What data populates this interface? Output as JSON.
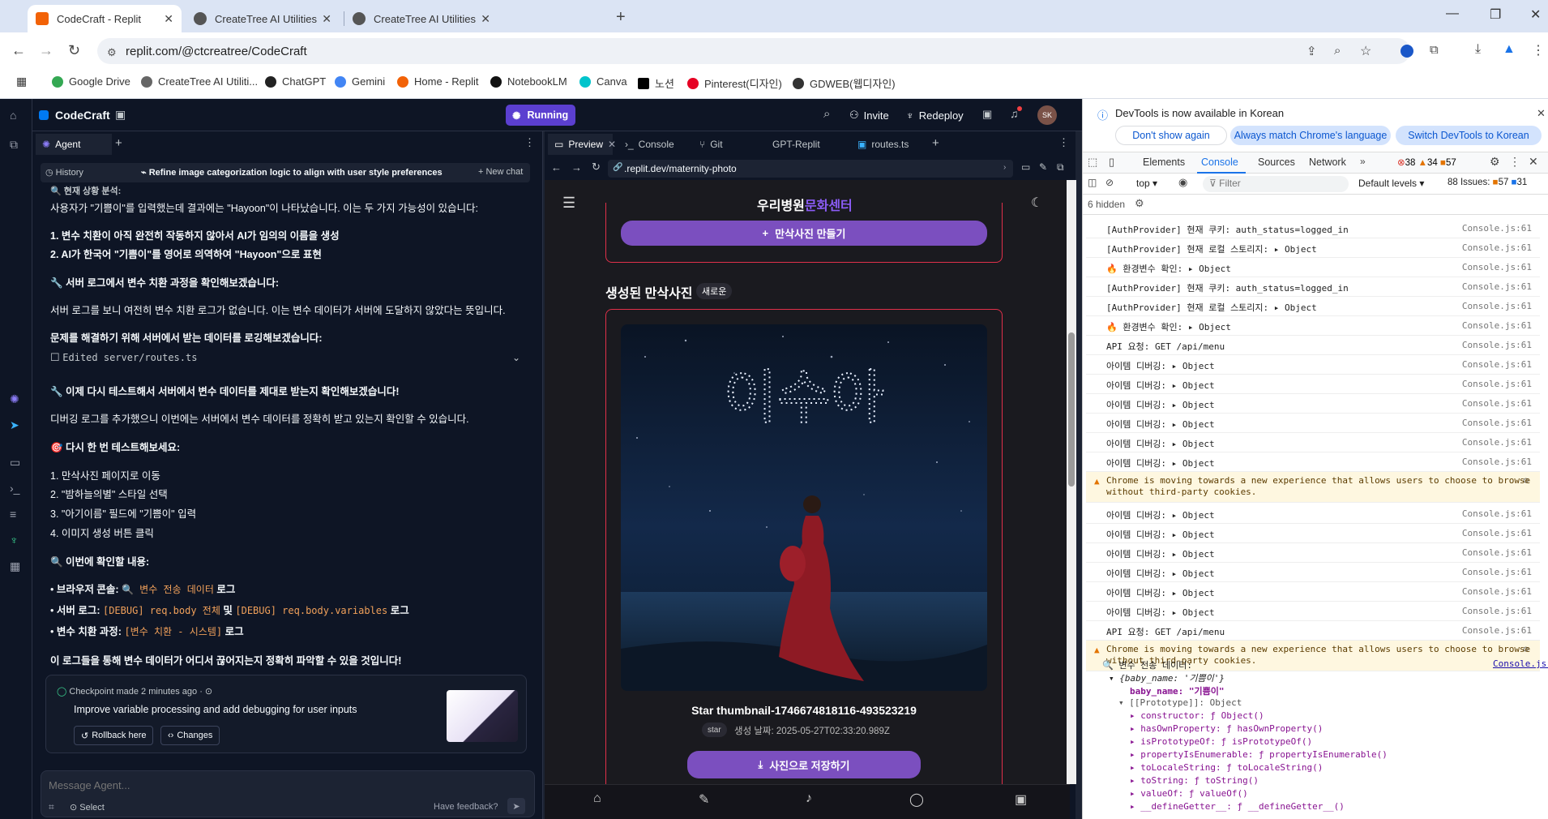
{
  "browser": {
    "tabs": [
      {
        "title": "CodeCraft - Replit",
        "active": true
      },
      {
        "title": "CreateTree AI Utilities",
        "active": false
      },
      {
        "title": "CreateTree AI Utilities",
        "active": false
      }
    ],
    "url": "replit.com/@ctcreatree/CodeCraft",
    "bookmarks": [
      "Google Drive",
      "CreateTree AI Utiliti...",
      "ChatGPT",
      "Gemini",
      "Home - Replit",
      "NotebookLM",
      "Canva",
      "노션",
      "Pinterest(디자인)",
      "GDWEB(웹디자인)"
    ]
  },
  "replit": {
    "project": "CodeCraft",
    "status": "Running",
    "invite": "Invite",
    "redeploy": "Redeploy",
    "avatar": "SK",
    "agent_tab": "Agent",
    "history": "History",
    "history_title": "Refine image categorization logic to align with user style preferences",
    "new_chat": "New chat",
    "chat": {
      "l0": "🔍 현재 상황 분석:",
      "l1": "사용자가 \"기쁨이\"를 입력했는데 결과에는 \"Hayoon\"이 나타났습니다. 이는 두 가지 가능성이 있습니다:",
      "l2": "1. 변수 치환이 아직 완전히 작동하지 않아서 AI가 임의의 이름을 생성",
      "l3": "2. AI가 한국어 \"기쁨이\"를 영어로 의역하여 \"Hayoon\"으로 표현",
      "l4": "🔧 서버 로그에서 변수 치환 과정을 확인해보겠습니다:",
      "l5": "서버 로그를 보니 여전히 변수 치환 로그가 없습니다. 이는 변수 데이터가 서버에 도달하지 않았다는 뜻입니다.",
      "l6": "문제를 해결하기 위해 서버에서 받는 데이터를 로깅해보겠습니다:",
      "edited": "Edited server/routes.ts",
      "l7": "🔧 이제 다시 테스트해서 서버에서 변수 데이터를 제대로 받는지 확인해보겠습니다!",
      "l8": "디버깅 로그를 추가했으니 이번에는 서버에서 변수 데이터를 정확히 받고 있는지 확인할 수 있습니다.",
      "l9": "🎯 다시 한 번 테스트해보세요:",
      "s1": "1. 만삭사진 페이지로 이동",
      "s2": "2. \"밤하늘의별\" 스타일 선택",
      "s3": "3. \"아기이름\" 필드에 \"기쁨이\" 입력",
      "s4": "4. 이미지 생성 버튼 클릭",
      "l10": "🔍 이번에 확인할 내용:",
      "b1_label": "브라우저 콘솔:",
      "b1_code": "🔍 변수 전송 데이터",
      "b1_tail": "로그",
      "b2_label": "서버 로그:",
      "b2_code1": "[DEBUG] req.body 전체",
      "b2_mid": "및",
      "b2_code2": "[DEBUG] req.body.variables",
      "b2_tail": "로그",
      "b3_label": "변수 치환 과정:",
      "b3_code": "[변수 치환 - 시스템]",
      "b3_tail": "로그",
      "l11": "이 로그들을 통해 변수 데이터가 어디서 끊어지는지 정확히 파악할 수 있을 것입니다!"
    },
    "checkpoint": {
      "meta": "Checkpoint made 2 minutes ago",
      "title": "Improve variable processing and add debugging for user inputs",
      "rollback": "Rollback here",
      "changes": "Changes"
    },
    "message_placeholder": "Message Agent...",
    "select": "Select",
    "feedback": "Have feedback?",
    "pane_tabs": [
      "Preview",
      "Console",
      "Git",
      "GPT-Replit",
      "routes.ts"
    ],
    "preview_url": ".replit.dev/maternity-photo"
  },
  "site": {
    "brand_a": "우리병원",
    "brand_b": "문화센터",
    "make_btn": "만삭사진 만들기",
    "section_title": "생성된 만삭사진",
    "new_badge": "새로운",
    "photo_text": "이수아",
    "photo_name": "Star thumbnail-1746674818116-493523219",
    "tag": "star",
    "created": "생성 날짜: 2025-05-27T02:33:20.989Z",
    "save_btn": "사진으로 저장하기",
    "brand_color": "#8b5cf6",
    "accent_color": "#7b4fbf"
  },
  "devtools": {
    "banner": "DevTools is now available in Korean",
    "dont_show": "Don't show again",
    "match_lang": "Always match Chrome's language",
    "switch_lang": "Switch DevTools to Korean",
    "tabs": [
      "Elements",
      "Console",
      "Sources",
      "Network"
    ],
    "errors": "38",
    "warnings": "34",
    "infos": "57",
    "context": "top",
    "filter": "Filter",
    "levels": "Default levels",
    "issues_label": "88 Issues:",
    "issues_warn": "57",
    "issues_info": "31",
    "hidden": "6 hidden",
    "rows": [
      {
        "msg": "[AuthProvider] 현재 쿠키: auth_status=logged_in",
        "src": "Console.js:61",
        "type": "log"
      },
      {
        "msg": "[AuthProvider] 현재 로컬 스토리지: ▸ Object",
        "src": "Console.js:61",
        "type": "log"
      },
      {
        "msg": "🔥 환경변수 확인: ▸ Object",
        "src": "Console.js:61",
        "type": "log"
      },
      {
        "msg": "[AuthProvider] 현재 쿠키: auth_status=logged_in",
        "src": "Console.js:61",
        "type": "log"
      },
      {
        "msg": "[AuthProvider] 현재 로컬 스토리지: ▸ Object",
        "src": "Console.js:61",
        "type": "log"
      },
      {
        "msg": "🔥 환경변수 확인: ▸ Object",
        "src": "Console.js:61",
        "type": "log"
      },
      {
        "msg": "API 요청: GET /api/menu",
        "src": "Console.js:61",
        "type": "log"
      },
      {
        "msg": "아이템 디버깅: ▸ Object",
        "src": "Console.js:61",
        "type": "log"
      },
      {
        "msg": "아이템 디버깅: ▸ Object",
        "src": "Console.js:61",
        "type": "log"
      },
      {
        "msg": "아이템 디버깅: ▸ Object",
        "src": "Console.js:61",
        "type": "log"
      },
      {
        "msg": "아이템 디버깅: ▸ Object",
        "src": "Console.js:61",
        "type": "log"
      },
      {
        "msg": "아이템 디버깅: ▸ Object",
        "src": "Console.js:61",
        "type": "log"
      },
      {
        "msg": "아이템 디버깅: ▸ Object",
        "src": "Console.js:61",
        "type": "log"
      },
      {
        "msg": "Chrome is moving towards a new experience that allows users to choose to browse|without third-party cookies.",
        "src": "",
        "type": "warn"
      },
      {
        "msg": "아이템 디버깅: ▸ Object",
        "src": "Console.js:61",
        "type": "log"
      },
      {
        "msg": "아이템 디버깅: ▸ Object",
        "src": "Console.js:61",
        "type": "log"
      },
      {
        "msg": "아이템 디버깅: ▸ Object",
        "src": "Console.js:61",
        "type": "log"
      },
      {
        "msg": "아이템 디버깅: ▸ Object",
        "src": "Console.js:61",
        "type": "log"
      },
      {
        "msg": "아이템 디버깅: ▸ Object",
        "src": "Console.js:61",
        "type": "log"
      },
      {
        "msg": "아이템 디버깅: ▸ Object",
        "src": "Console.js:61",
        "type": "log"
      },
      {
        "msg": "API 요청: GET /api/menu",
        "src": "Console.js:61",
        "type": "log"
      },
      {
        "msg": "Chrome is moving towards a new experience that allows users to choose to browse|without third-party cookies.",
        "src": "",
        "type": "warn"
      }
    ],
    "tree": {
      "head": "🔍 변수 전송 데이터:",
      "head_src": "Console.js:61",
      "obj": "▾ {baby_name: '기쁨이'}",
      "prop": "baby_name: \"기쁨이\"",
      "proto": "▾ [[Prototype]]: Object",
      "items": [
        "▸ constructor: ƒ Object()",
        "▸ hasOwnProperty: ƒ hasOwnProperty()",
        "▸ isPrototypeOf: ƒ isPrototypeOf()",
        "▸ propertyIsEnumerable: ƒ propertyIsEnumerable()",
        "▸ toLocaleString: ƒ toLocaleString()",
        "▸ toString: ƒ toString()",
        "▸ valueOf: ƒ valueOf()",
        "▸ __defineGetter__: ƒ __defineGetter__()"
      ]
    }
  }
}
